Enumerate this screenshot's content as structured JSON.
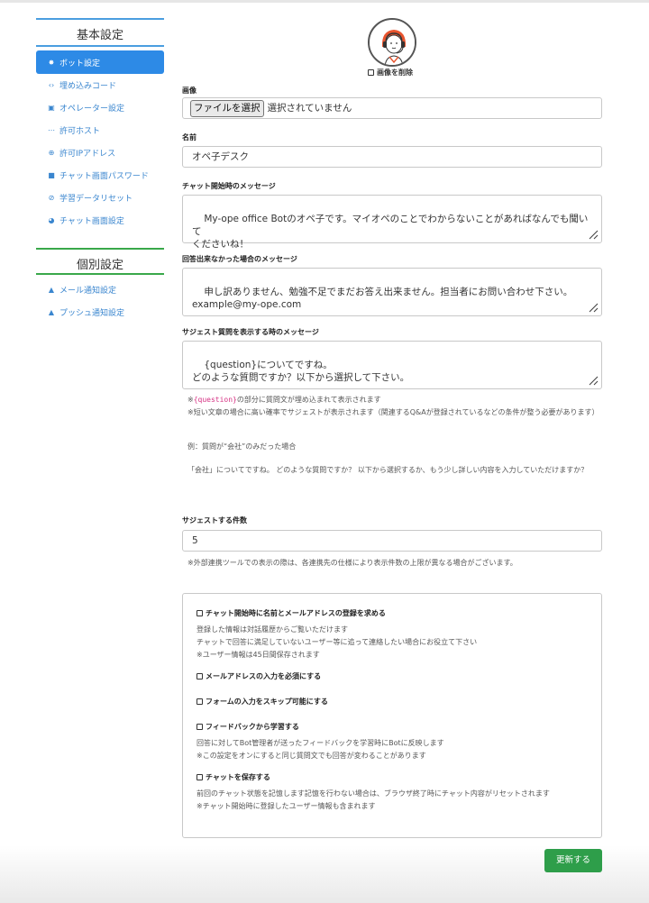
{
  "sidebar": {
    "basic_title": "基本設定",
    "basic_items": [
      {
        "icon": "gear-icon",
        "glyph": "✸",
        "label": "ボット設定",
        "active": true
      },
      {
        "icon": "code-icon",
        "glyph": "‹›",
        "label": "埋め込みコード"
      },
      {
        "icon": "user-card-icon",
        "glyph": "▣",
        "label": "オペレーター設定"
      },
      {
        "icon": "host-icon",
        "glyph": "⋯",
        "label": "許可ホスト"
      },
      {
        "icon": "globe-icon",
        "glyph": "⊕",
        "label": "許可IPアドレス"
      },
      {
        "icon": "lock-icon",
        "glyph": "■",
        "label": "チャット画面パスワード"
      },
      {
        "icon": "reset-icon",
        "glyph": "⊘",
        "label": "学習データリセット"
      },
      {
        "icon": "palette-icon",
        "glyph": "◕",
        "label": "チャット画面設定"
      }
    ],
    "individual_title": "個別設定",
    "individual_items": [
      {
        "icon": "bell-icon",
        "glyph": "▲",
        "label": "メール通知設定"
      },
      {
        "icon": "bell-icon",
        "glyph": "▲",
        "label": "プッシュ通知設定"
      }
    ]
  },
  "form": {
    "delete_image_label": "画像を削除",
    "image_label": "画像",
    "file_button": "ファイルを選択",
    "file_status": "選択されていません",
    "name_label": "名前",
    "name_value": "オペ子デスク",
    "start_msg_label": "チャット開始時のメッセージ",
    "start_msg_value": "My-ope office Botのオペ子です。マイオペのことでわからないことがあればなんでも聞いて\nくださいね！",
    "no_answer_label": "回答出来なかった場合のメッセージ",
    "no_answer_value": "申し訳ありません、勉強不足でまだお答え出来ません。担当者にお問い合わせ下さい。\nexample@my-ope.com",
    "suggest_msg_label": "サジェスト質問を表示する時のメッセージ",
    "suggest_msg_value": "{question}についてですね。\nどのような質問ですか？以下から選択して下さい。",
    "note_code": "{question}",
    "note_line1_suffix": "の部分に質問文が埋め込まれて表示されます",
    "note_prefix": "※",
    "note_line2": "※短い文章の場合に高い確率でサジェストが表示されます（関連するQ&Aが登録されているなどの条件が整う必要があります）",
    "example_title": "例：質問が“会社”のみだった場合",
    "example_text": "「会社」についてですね。 どのような質問ですか？ 以下から選択するか、もう少し詳しい内容を入力していただけますか？",
    "suggest_count_label": "サジェストする件数",
    "suggest_count_value": "5",
    "suggest_count_note": "※外部連携ツールでの表示の際は、各連携先の仕様により表示件数の上限が異なる場合がございます。",
    "options": [
      {
        "title": "チャット開始時に名前とメールアドレスの登録を求める",
        "desc": "登録した情報は対話履歴からご覧いただけます\nチャットで回答に満足していないユーザー等に追って連絡したい場合にお役立て下さい\n※ユーザー情報は45日間保存されます"
      },
      {
        "title": "メールアドレスの入力を必須にする",
        "desc": ""
      },
      {
        "title": "フォームの入力をスキップ可能にする",
        "desc": ""
      },
      {
        "title": "フィードバックから学習する",
        "desc": "回答に対してBot管理者が送ったフィードバックを学習時にBotに反映します\n※この設定をオンにすると同じ質問文でも回答が変わることがあります"
      },
      {
        "title": "チャットを保存する",
        "desc": "前回のチャット状態を記憶します記憶を行わない場合は、ブラウザ終了時にチャット内容がリセットされます\n※チャット開始時に登録したユーザー情報も含まれます"
      }
    ],
    "update_button": "更新する"
  },
  "colors": {
    "accent_blue": "#2d8ae6",
    "link_blue": "#3a86cf",
    "section_green": "#39a84a",
    "button_green": "#2e9e4a"
  }
}
